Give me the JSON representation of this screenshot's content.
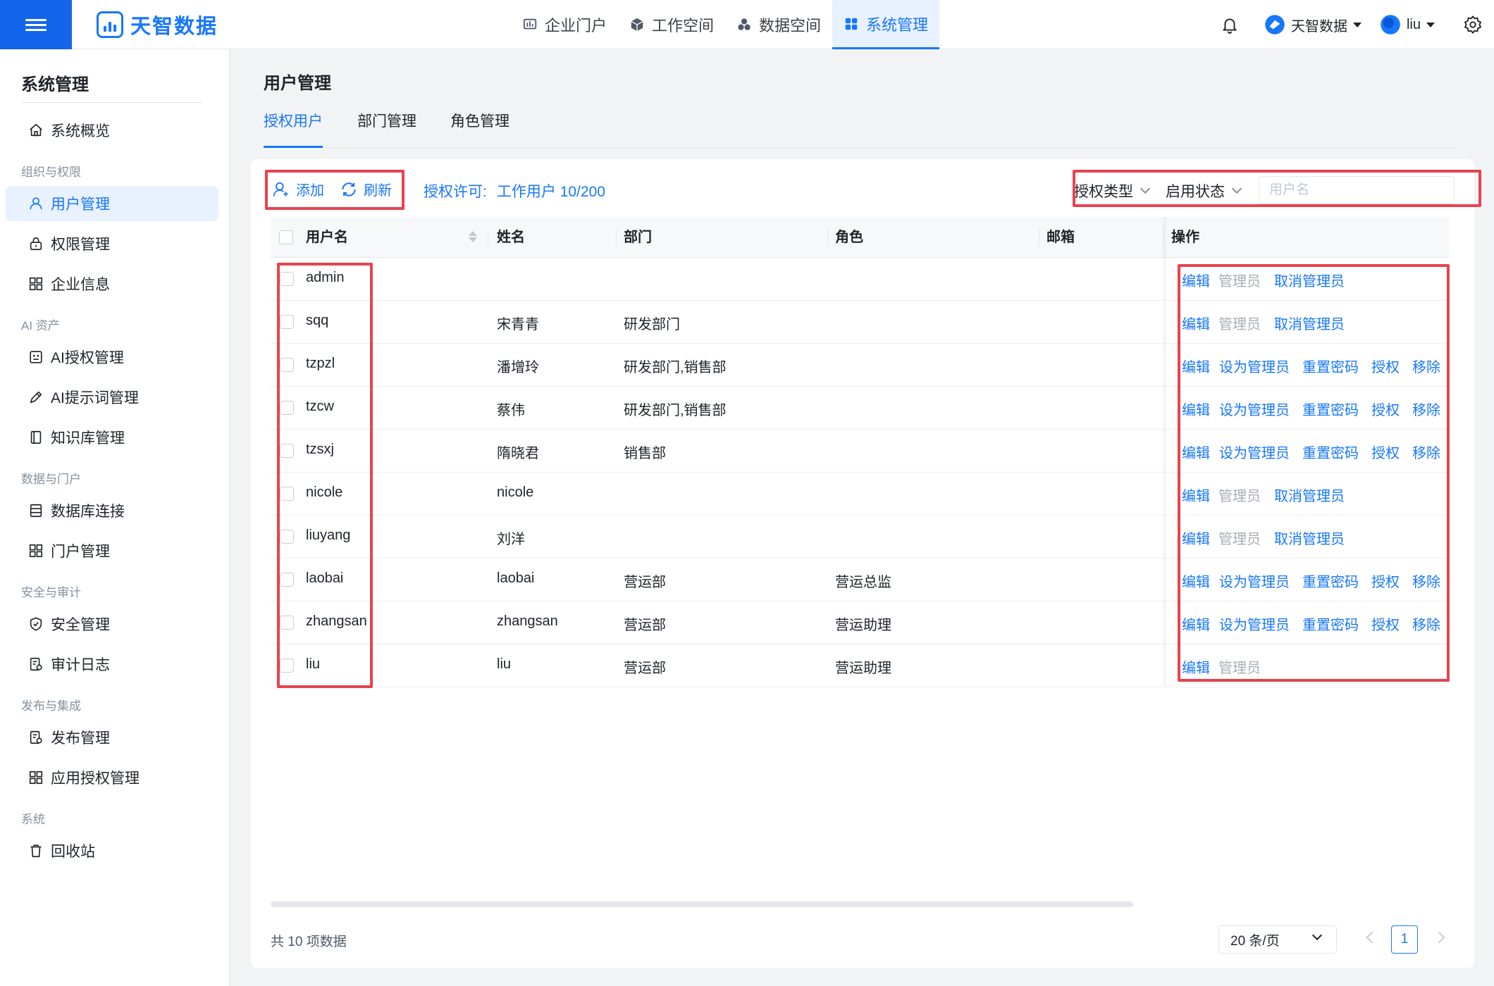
{
  "brand": {
    "name": "天智数据"
  },
  "topnav": [
    {
      "label": "企业门户",
      "icon": "dashboard-icon"
    },
    {
      "label": "工作空间",
      "icon": "cube-icon"
    },
    {
      "label": "数据空间",
      "icon": "cubes-icon"
    },
    {
      "label": "系统管理",
      "icon": "grid-icon",
      "active": true
    }
  ],
  "topright": {
    "workspace": "天智数据",
    "user": "liu"
  },
  "sidebar": {
    "title": "系统管理",
    "overview": "系统概览",
    "groups": [
      {
        "label": "组织与权限",
        "items": [
          "用户管理",
          "权限管理",
          "企业信息"
        ]
      },
      {
        "label": "AI 资产",
        "items": [
          "AI授权管理",
          "AI提示词管理",
          "知识库管理"
        ]
      },
      {
        "label": "数据与门户",
        "items": [
          "数据库连接",
          "门户管理"
        ]
      },
      {
        "label": "安全与审计",
        "items": [
          "安全管理",
          "审计日志"
        ]
      },
      {
        "label": "发布与集成",
        "items": [
          "发布管理",
          "应用授权管理"
        ]
      },
      {
        "label": "系统",
        "items": [
          "回收站"
        ]
      }
    ]
  },
  "page": {
    "title": "用户管理",
    "tabs": [
      "授权用户",
      "部门管理",
      "角色管理"
    ]
  },
  "toolbar": {
    "add": "添加",
    "refresh": "刷新",
    "license_label": "授权许可:",
    "license_value": "工作用户 10/200",
    "filter_type": "授权类型",
    "filter_status": "启用状态",
    "search_placeholder": "用户名"
  },
  "table": {
    "columns": [
      "用户名",
      "姓名",
      "部门",
      "角色",
      "邮箱",
      "操作"
    ],
    "rows": [
      {
        "username": "admin",
        "name": "",
        "dept": "",
        "role": "",
        "email": "",
        "ops": [
          "编辑",
          "管理员",
          "取消管理员"
        ]
      },
      {
        "username": "sqq",
        "name": "宋青青",
        "dept": "研发部门",
        "role": "",
        "email": "",
        "ops": [
          "编辑",
          "管理员",
          "取消管理员"
        ]
      },
      {
        "username": "tzpzl",
        "name": "潘增玲",
        "dept": "研发部门,销售部",
        "role": "",
        "email": "",
        "ops": [
          "编辑",
          "设为管理员",
          "重置密码",
          "授权",
          "移除"
        ]
      },
      {
        "username": "tzcw",
        "name": "蔡伟",
        "dept": "研发部门,销售部",
        "role": "",
        "email": "",
        "ops": [
          "编辑",
          "设为管理员",
          "重置密码",
          "授权",
          "移除"
        ]
      },
      {
        "username": "tzsxj",
        "name": "隋晓君",
        "dept": "销售部",
        "role": "",
        "email": "",
        "ops": [
          "编辑",
          "设为管理员",
          "重置密码",
          "授权",
          "移除"
        ]
      },
      {
        "username": "nicole",
        "name": "nicole",
        "dept": "",
        "role": "",
        "email": "",
        "ops": [
          "编辑",
          "管理员",
          "取消管理员"
        ]
      },
      {
        "username": "liuyang",
        "name": "刘洋",
        "dept": "",
        "role": "",
        "email": "",
        "ops": [
          "编辑",
          "管理员",
          "取消管理员"
        ]
      },
      {
        "username": "laobai",
        "name": "laobai",
        "dept": "营运部",
        "role": "营运总监",
        "email": "",
        "ops": [
          "编辑",
          "设为管理员",
          "重置密码",
          "授权",
          "移除"
        ]
      },
      {
        "username": "zhangsan",
        "name": "zhangsan",
        "dept": "营运部",
        "role": "营运助理",
        "email": "",
        "ops": [
          "编辑",
          "设为管理员",
          "重置密码",
          "授权",
          "移除"
        ]
      },
      {
        "username": "liu",
        "name": "liu",
        "dept": "营运部",
        "role": "营运助理",
        "email": "",
        "ops": [
          "编辑",
          "管理员"
        ]
      }
    ]
  },
  "pagination": {
    "total": "共 10 项数据",
    "page_size": "20 条/页",
    "current": "1"
  },
  "colors": {
    "accent": "#1677ff",
    "highlight": "#e8424f",
    "muted": "#a8adb5"
  }
}
